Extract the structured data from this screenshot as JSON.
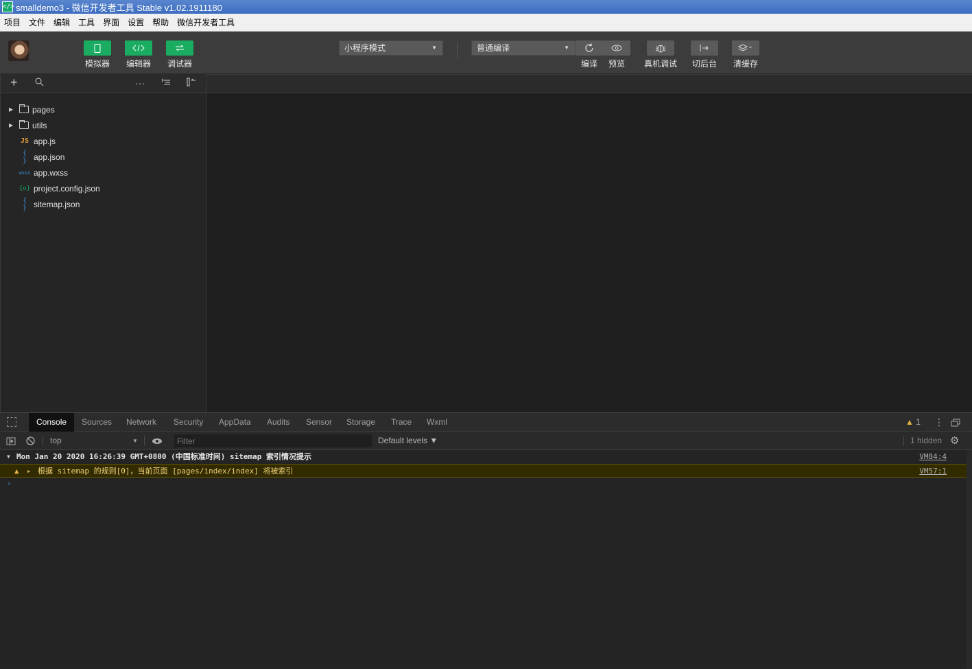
{
  "window": {
    "title": "smalldemo3 - 微信开发者工具 Stable v1.02.1911180",
    "icon_text": "</>"
  },
  "menubar": [
    "项目",
    "文件",
    "编辑",
    "工具",
    "界面",
    "设置",
    "帮助",
    "微信开发者工具"
  ],
  "toolbar": {
    "simulator": "模拟器",
    "editor": "编辑器",
    "debugger": "调试器",
    "mode_select": "小程序模式",
    "compile_select": "普通编译",
    "compile": "编译",
    "preview": "预览",
    "remote_debug": "真机调试",
    "background": "切后台",
    "clear_cache": "清缓存",
    "accent_color": "#1aad62"
  },
  "sidebar": {
    "tree": [
      {
        "name": "pages",
        "type": "folder"
      },
      {
        "name": "utils",
        "type": "folder"
      },
      {
        "name": "app.js",
        "type": "js",
        "icon": "JS",
        "color": "#e6a13c"
      },
      {
        "name": "app.json",
        "type": "json",
        "icon": "{ }",
        "color": "#3d8fd9"
      },
      {
        "name": "app.wxss",
        "type": "wxss",
        "icon": "wxss",
        "color": "#3d8fd9"
      },
      {
        "name": "project.config.json",
        "type": "config",
        "icon": "{o}",
        "color": "#1aad62"
      },
      {
        "name": "sitemap.json",
        "type": "json",
        "icon": "{ }",
        "color": "#3d8fd9"
      }
    ]
  },
  "devtools": {
    "tabs": [
      "Console",
      "Sources",
      "Network",
      "Security",
      "AppData",
      "Audits",
      "Sensor",
      "Storage",
      "Trace",
      "Wxml"
    ],
    "active_tab": "Console",
    "warning_count": "1",
    "context": "top",
    "filter_placeholder": "Filter",
    "levels": "Default levels ▼",
    "hidden": "1 hidden",
    "logs": {
      "group_text": "Mon Jan 20 2020 16:26:39 GMT+0800 (中国标准时间) sitemap 索引情况提示",
      "group_src": "VM84:4",
      "warn_text": "根据 sitemap 的规则[0]，当前页面 [pages/index/index] 将被索引",
      "warn_src": "VM57:1",
      "prompt": "›"
    }
  }
}
